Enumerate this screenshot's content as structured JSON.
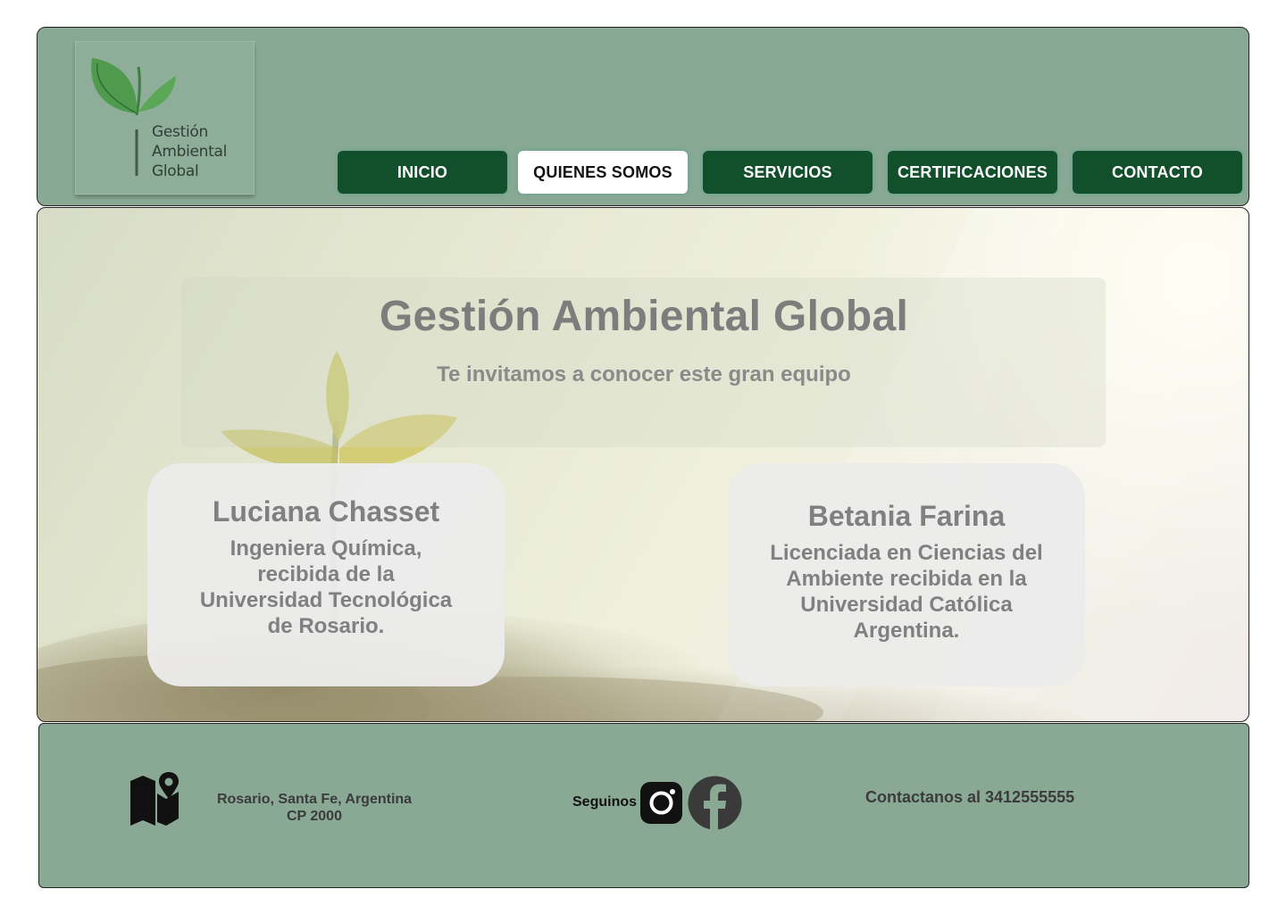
{
  "logo": {
    "lines": [
      "Gestión",
      "Ambiental",
      "Global"
    ]
  },
  "nav": {
    "items": [
      {
        "label": "INICIO",
        "active": false
      },
      {
        "label": "QUIENES SOMOS",
        "active": true
      },
      {
        "label": "SERVICIOS",
        "active": false
      },
      {
        "label": "CERTIFICACIONES",
        "active": false
      },
      {
        "label": "CONTACTO",
        "active": false
      }
    ]
  },
  "hero": {
    "title": "Gestión Ambiental Global",
    "subtitle": "Te invitamos a conocer este gran equipo"
  },
  "team": [
    {
      "name": "Luciana Chasset",
      "description": "Ingeniera Química, recibida de la Universidad Tecnológica de Rosario."
    },
    {
      "name": "Betania Farina",
      "description": "Licenciada en Ciencias del Ambiente recibida en la Universidad Católica Argentina."
    }
  ],
  "footer": {
    "address_line1": "Rosario, Santa Fe, Argentina",
    "address_line2": "CP 2000",
    "follow_label": "Seguinos",
    "contact": "Contactanos al 3412555555",
    "icons": [
      "map-pin-icon",
      "instagram-icon",
      "facebook-icon"
    ]
  },
  "colors": {
    "header_bg": "#89a995",
    "nav_bg": "#12502c",
    "nav_active_bg": "#ffffff",
    "card_bg": "#ebebeb",
    "text_gray": "#808080"
  }
}
